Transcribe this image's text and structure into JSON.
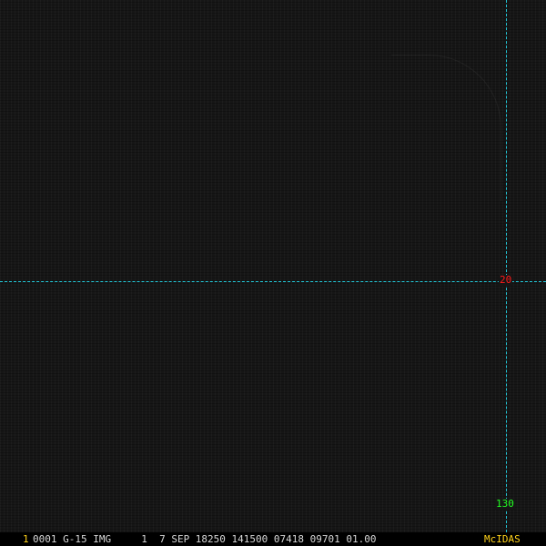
{
  "overlay": {
    "latitude_label": "20",
    "longitude_label": "130",
    "latitude_color": "#ff1a1a",
    "longitude_color": "#22ff22",
    "grid_color": "#22c7d8"
  },
  "status_bar": {
    "frame_number": "1",
    "info": "0001 G-15 IMG     1  7 SEP 18250 141500 07418 09701 01.00",
    "app_name": "McIDAS"
  }
}
